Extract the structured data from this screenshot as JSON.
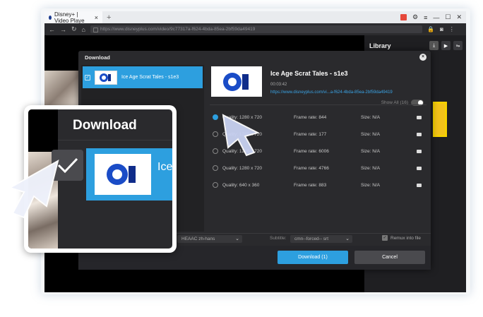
{
  "browser": {
    "tab_title": "Disney+ | Video Playe",
    "url": "https://www.disneyplus.com/video/9c77317a-f624-4bda-85ea-2bf59da49419"
  },
  "library": {
    "title": "Library"
  },
  "dialog": {
    "title": "Download",
    "item_label": "Ice Age Scrat Tales - s1e3",
    "video_title": "Ice Age Scrat Tales - s1e3",
    "duration": "00:03:42",
    "video_url": "https://www.disneyplus.com/vi...a-f624-4bda-85ea-2bf59da49419",
    "show_all": "Show All (16)",
    "qualities": [
      {
        "quality": "Quality: 1280 x 720",
        "frame": "Frame rate: 844",
        "size": "Size: N/A",
        "selected": true
      },
      {
        "quality": "Quality: 1280 x 720",
        "frame": "Frame rate: 177",
        "size": "Size: N/A",
        "selected": false
      },
      {
        "quality": "Quality: 1280 x 720",
        "frame": "Frame rate: 6006",
        "size": "Size: N/A",
        "selected": false
      },
      {
        "quality": "Quality: 1280 x 720",
        "frame": "Frame rate: 4766",
        "size": "Size: N/A",
        "selected": false
      },
      {
        "quality": "Quality: 640 x 360",
        "frame": "Frame rate: 883",
        "size": "Size: N/A",
        "selected": false
      }
    ],
    "audio_value": "HEAAC zh-hans",
    "subtitle_label": "Subtitle:",
    "subtitle_value": "cmn--forced-- srt",
    "remux_label": "Remux into file",
    "download_button": "Download (1)",
    "cancel_button": "Cancel"
  },
  "zoom": {
    "title": "Download",
    "item_partial": "Ice"
  },
  "colors": {
    "accent": "#2d9fdf",
    "dialog_bg": "#2a2a2d",
    "library_bg": "#1f1f22"
  }
}
